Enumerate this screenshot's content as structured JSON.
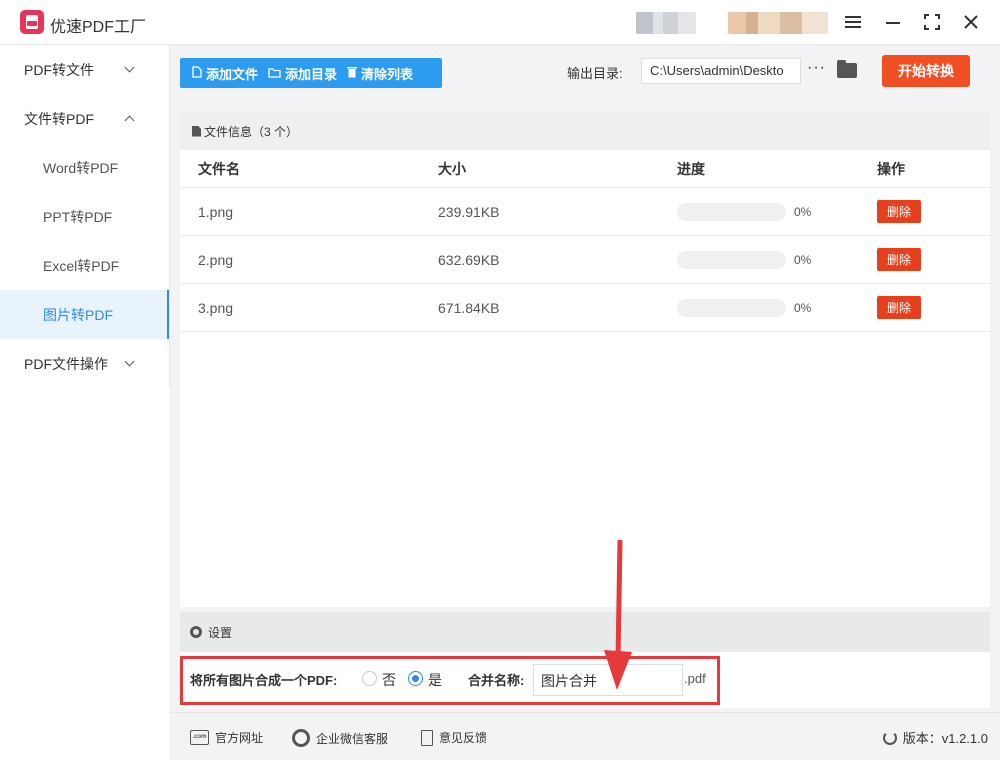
{
  "app": {
    "title": "优速PDF工厂"
  },
  "window": {
    "menu_icon": "hamburger-icon",
    "minimize_icon": "minimize-icon",
    "maximize_icon": "fullscreen-icon",
    "close_icon": "close-icon"
  },
  "sidebar": {
    "items": [
      {
        "label": "PDF转文件",
        "expandable": true,
        "expanded": false
      },
      {
        "label": "文件转PDF",
        "expandable": true,
        "expanded": true
      },
      {
        "label": "Word转PDF",
        "sub": true
      },
      {
        "label": "PPT转PDF",
        "sub": true
      },
      {
        "label": "Excel转PDF",
        "sub": true
      },
      {
        "label": "图片转PDF",
        "sub": true,
        "active": true
      },
      {
        "label": "PDF文件操作",
        "expandable": true,
        "expanded": false
      }
    ]
  },
  "toolbar": {
    "add_file": "添加文件",
    "add_folder": "添加目录",
    "clear_list": "清除列表",
    "output_label": "输出目录:",
    "output_path": "C:\\Users\\admin\\Deskto",
    "more": "···",
    "start": "开始转换"
  },
  "file_list": {
    "title": "文件信息（3 个）",
    "columns": [
      "文件名",
      "大小",
      "进度",
      "操作"
    ],
    "rows": [
      {
        "name": "1.png",
        "size": "239.91KB",
        "progress": 0,
        "progress_text": "0%",
        "action": "删除"
      },
      {
        "name": "2.png",
        "size": "632.69KB",
        "progress": 0,
        "progress_text": "0%",
        "action": "删除"
      },
      {
        "name": "3.png",
        "size": "671.84KB",
        "progress": 0,
        "progress_text": "0%",
        "action": "删除"
      }
    ]
  },
  "settings": {
    "title": "设置",
    "merge_label": "将所有图片合成一个PDF:",
    "option_no": "否",
    "option_yes": "是",
    "selected": "是",
    "name_label": "合并名称:",
    "name_value": "图片合并",
    "extension": ".pdf"
  },
  "footer": {
    "website": "官方网址",
    "wechat": "企业微信客服",
    "feedback": "意见反馈",
    "version": "版本：v1.2.1.0"
  },
  "colors": {
    "accent": "#2d8cf0",
    "toolbar": "#2d9cf0",
    "start": "#f04e23",
    "delete": "#e63f1c",
    "annotation": "#e6393b",
    "logo": "#e8345a"
  }
}
